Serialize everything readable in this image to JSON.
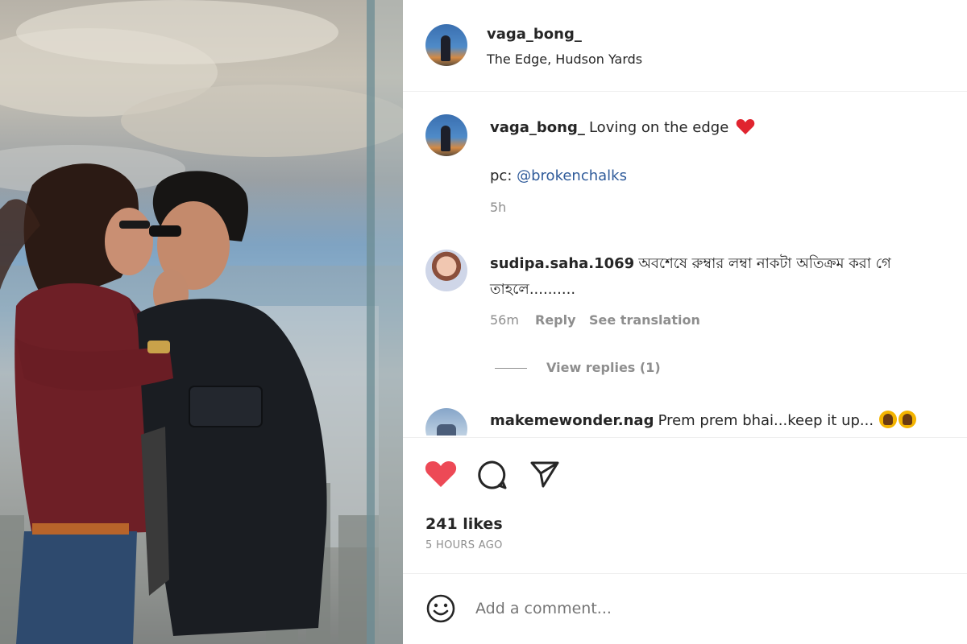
{
  "post": {
    "author": "vaga_bong_",
    "location": "The Edge, Hudson Yards"
  },
  "caption": {
    "username": "vaga_bong_",
    "text": "Loving on the edge",
    "credit_prefix": "pc:",
    "credit_handle": "@brokenchalks",
    "time": "5h"
  },
  "comments": [
    {
      "username": "sudipa.saha.1069",
      "text_line1": "অবশেষে রুম্বার লম্বা নাকটা অতিক্রম করা গে",
      "text_line2": "তাহলে..........",
      "time": "56m",
      "reply": "Reply",
      "translate": "See translation",
      "view_replies": "View replies (1)"
    },
    {
      "username": "makemewonder.nag",
      "text": "Prem prem bhai...keep it up..."
    }
  ],
  "stats": {
    "likes": "241 likes",
    "posted": "5 HOURS AGO"
  },
  "composer": {
    "placeholder": "Add a comment..."
  },
  "colors": {
    "like_active": "#ed4956",
    "link": "#2f5b9a",
    "muted": "#8e8e8e"
  },
  "icons": [
    "heart-icon",
    "comment-icon",
    "share-icon",
    "emoji-icon"
  ]
}
